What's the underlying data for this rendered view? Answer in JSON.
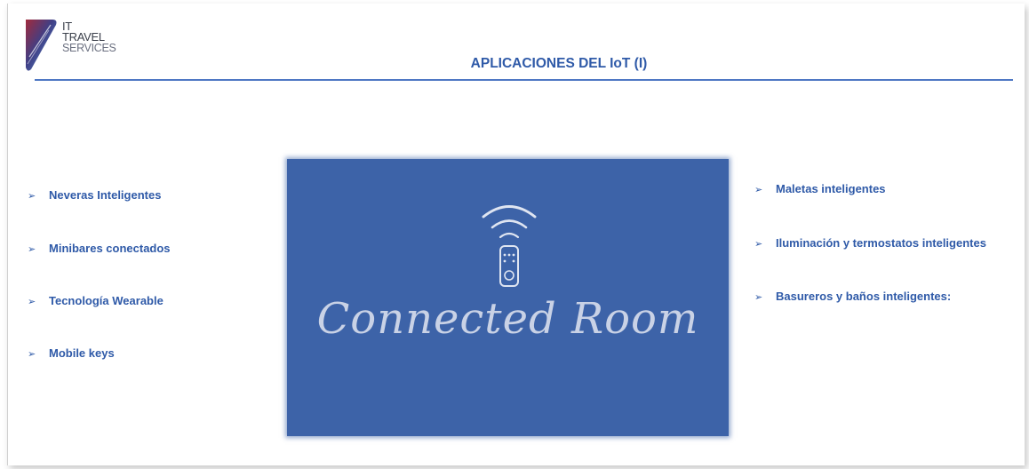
{
  "logo": {
    "line1": "IT",
    "line2": "TRAVEL",
    "line3": "SERVICES"
  },
  "title": "APLICACIONES DEL IoT (I)",
  "left_items": [
    "Neveras Inteligentes",
    "Minibares conectados",
    "Tecnología Wearable",
    "Mobile keys"
  ],
  "right_items": [
    "Maletas inteligentes",
    "Iluminación y termostatos inteligentes",
    "Basureros y baños inteligentes:"
  ],
  "bullet": "➢",
  "image": {
    "caption": "Connected Room",
    "icon": "wifi-remote-icon"
  },
  "colors": {
    "accent": "#2f5aa8",
    "image_bg": "#3d63a8",
    "rule": "#4f78c4"
  }
}
